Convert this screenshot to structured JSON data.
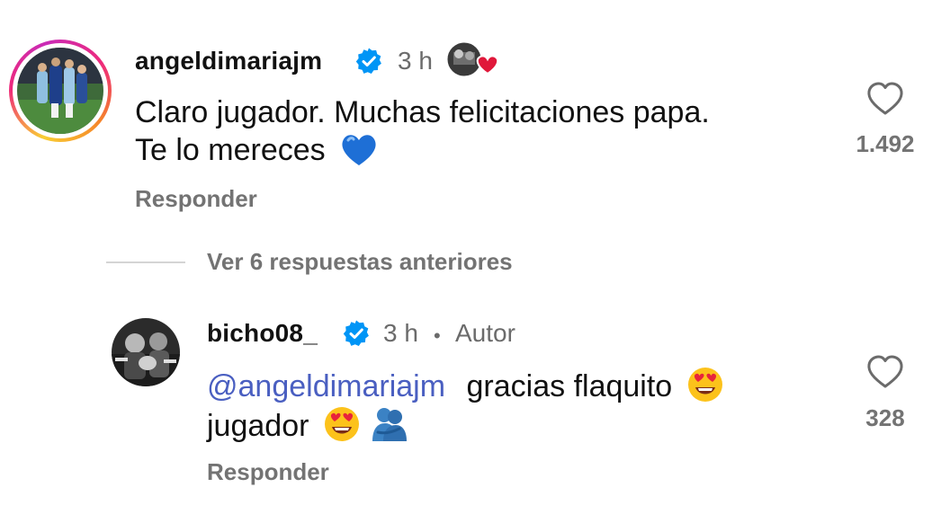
{
  "comments": [
    {
      "username": "angeldimariajm",
      "verified": true,
      "time": "3 h",
      "text_line1": "Claro jugador. Muchas felicitaciones papa.",
      "text_line2": "Te lo mereces",
      "reply_label": "Responder",
      "likes": "1.492"
    },
    {
      "username": "bicho08_",
      "verified": true,
      "time": "3 h",
      "separator": "•",
      "author_label": "Autor",
      "mention": "@angeldimariajm",
      "text_line1": "gracias flaquito",
      "text_line2": "jugador",
      "reply_label": "Responder",
      "likes": "328"
    }
  ],
  "thread": {
    "view_replies_label": "Ver 6 respuestas anteriores"
  },
  "colors": {
    "verified": "#0095f6",
    "mention": "#4a5fc1",
    "secondary_text": "#737373",
    "story_ring": [
      "#f9ce34",
      "#ee2a7b",
      "#c92bb7"
    ]
  },
  "icons": {
    "verified": "verified-badge-icon",
    "like": "heart-outline-icon",
    "blue_heart": "blue-heart-emoji",
    "heart_eyes": "heart-eyes-emoji",
    "hug": "people-hugging-emoji",
    "liked_by_author": "author-liked-heart-icon"
  }
}
